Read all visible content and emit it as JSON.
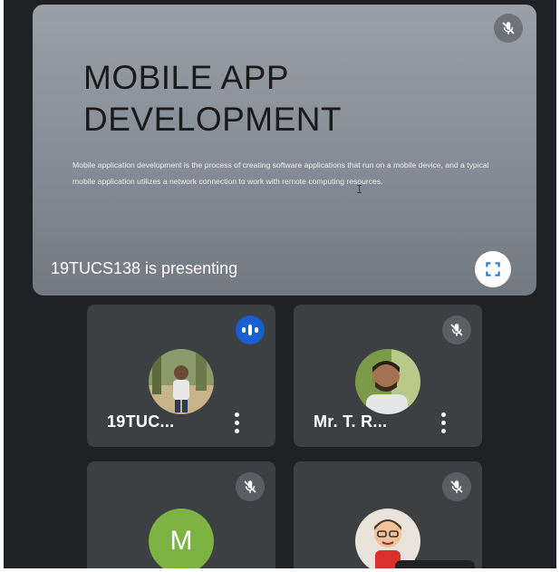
{
  "presentation": {
    "slide_title_line1": "MOBILE APP",
    "slide_title_line2": "DEVELOPMENT",
    "slide_body": "Mobile application development is the process of creating software applications that run on a mobile device, and a typical mobile application utilizes a network connection to work with remote computing resources.",
    "presenting_label": "19TUCS138 is presenting",
    "mute_icon": "mic-off-icon",
    "fullscreen_icon": "fullscreen-icon"
  },
  "participants": [
    {
      "name": "19TUC...",
      "avatar": "photo",
      "status_icon": "speaking-indicator-icon",
      "menu_icon": "more-vert-icon"
    },
    {
      "name": "Mr. T. R...",
      "avatar": "photo",
      "status_icon": "mic-off-icon",
      "menu_icon": "more-vert-icon"
    },
    {
      "name": "",
      "avatar_letter": "M",
      "status_icon": "mic-off-icon"
    },
    {
      "name": "",
      "avatar": "bitmoji",
      "status_icon": "mic-off-icon"
    }
  ],
  "colors": {
    "background": "#202124",
    "tile": "#3c4043",
    "speaking": "#1a5fd0",
    "avatar_m": "#7cb342"
  }
}
